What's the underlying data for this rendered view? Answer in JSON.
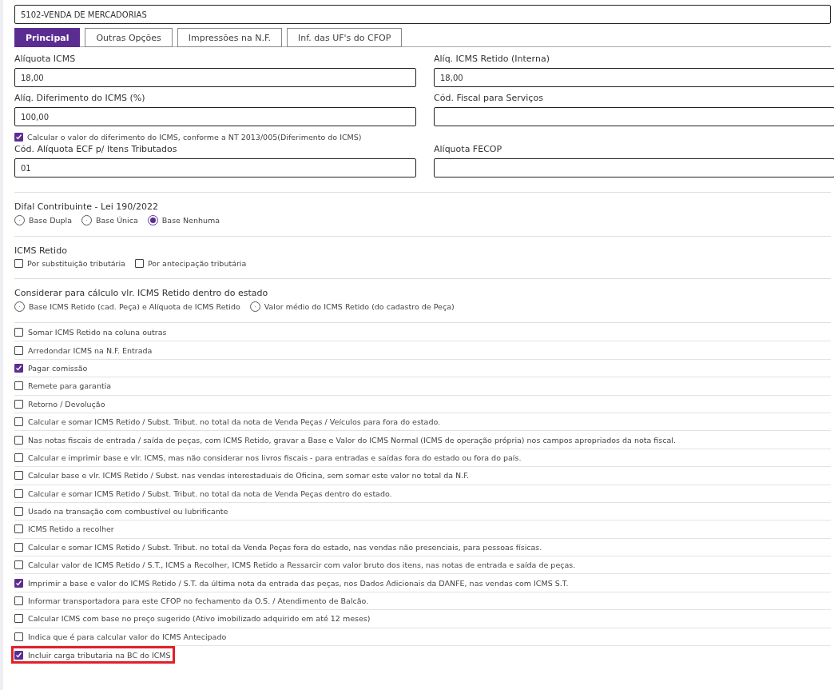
{
  "cfop_field": {
    "value": "5102-VENDA DE MERCADORIAS"
  },
  "tabs": [
    {
      "label": "Principal",
      "selected": true
    },
    {
      "label": "Outras Opções",
      "selected": false
    },
    {
      "label": "Impressões na N.F.",
      "selected": false
    },
    {
      "label": "Inf. das UF's do CFOP",
      "selected": false
    }
  ],
  "fields_row_1": [
    {
      "label": "Alíquota ICMS",
      "value": "18,00"
    },
    {
      "label": "Alíq. ICMS Retido (Interna)",
      "value": "18,00"
    }
  ],
  "fields_row_2": [
    {
      "label": "Alíq. Diferimento do ICMS (%)",
      "value": "100,00"
    },
    {
      "label": "Cód. Fiscal para Serviços"
    }
  ],
  "deferral_checkbox": {
    "label": "Calcular o valor do diferimento do ICMS, conforme a NT 2013/005(Diferimento do ICMS)",
    "checked": true
  },
  "fields_row_3": [
    {
      "label": "Cód. Alíquota ECF p/ Itens Tributados",
      "value": "01"
    },
    {
      "label": "Alíquota FECOP"
    }
  ],
  "difal": {
    "title": "Difal Contribuinte - Lei 190/2022",
    "options": [
      {
        "label": "Base Dupla",
        "selected": false
      },
      {
        "label": "Base Única",
        "selected": false
      },
      {
        "label": "Base Nenhuma",
        "selected": true
      }
    ]
  },
  "icms_retido": {
    "title": "ICMS Retido",
    "options": [
      {
        "label": "Por substituição tributária",
        "checked": false
      },
      {
        "label": "Por antecipação tributária",
        "checked": false
      }
    ]
  },
  "considerar": {
    "title": "Considerar para cálculo vlr. ICMS Retido dentro do estado",
    "options": [
      {
        "label": "Base ICMS Retido (cad. Peça) e Alíquota de ICMS Retido",
        "selected": false
      },
      {
        "label": "Valor médio do ICMS Retido (do cadastro de Peça)",
        "selected": false
      }
    ]
  },
  "options": [
    {
      "label": "Somar ICMS Retido na coluna outras",
      "checked": false
    },
    {
      "label": "Arredondar ICMS na N.F. Entrada",
      "checked": false
    },
    {
      "label": "Pagar comissão",
      "checked": true
    },
    {
      "label": "Remete para garantia",
      "checked": false
    },
    {
      "label": "Retorno / Devolução",
      "checked": false
    },
    {
      "label": "Calcular e somar ICMS Retido / Subst. Tribut. no total da nota de Venda Peças / Veículos para fora do estado.",
      "checked": false
    },
    {
      "label": "Nas notas fiscais de entrada / saída de peças, com ICMS Retido, gravar a Base e Valor do ICMS Normal (ICMS de operação própria) nos campos apropriados da nota fiscal.",
      "checked": false
    },
    {
      "label": "Calcular e imprimir base e vlr. ICMS, mas não considerar nos livros fiscais - para entradas e saídas fora do estado ou fora do país.",
      "checked": false
    },
    {
      "label": "Calcular base e vlr. ICMS Retido / Subst. nas vendas interestaduais de Oficina, sem somar este valor no total da N.F.",
      "checked": false
    },
    {
      "label": "Calcular e somar ICMS Retido / Subst. Tribut. no total da nota de Venda Peças dentro do estado.",
      "checked": false
    },
    {
      "label": "Usado na transação com combustível ou lubrificante",
      "checked": false
    },
    {
      "label": "ICMS Retido a recolher",
      "checked": false
    },
    {
      "label": "Calcular e somar ICMS Retido / Subst. Tribut. no total da Venda Peças fora do estado, nas vendas não presenciais, para pessoas físicas.",
      "checked": false
    },
    {
      "label": "Calcular valor de ICMS Retido / S.T., ICMS a Recolher, ICMS Retido a Ressarcir com valor bruto dos itens, nas notas de entrada e saída de peças.",
      "checked": false
    },
    {
      "label": "Imprimir a base e valor do ICMS Retido / S.T. da última nota da entrada das peças, nos Dados Adicionais da DANFE, nas vendas com ICMS S.T.",
      "checked": true
    },
    {
      "label": "Informar transportadora para este CFOP no fechamento da O.S. / Atendimento de Balcão.",
      "checked": false
    },
    {
      "label": "Calcular ICMS com base no preço sugerido (Ativo imobilizado adquirido em até 12 meses)",
      "checked": false
    },
    {
      "label": "Indica que é para calcular valor do ICMS Antecipado",
      "checked": false
    },
    {
      "label": "Incluir carga tributaria na BC do ICMS",
      "checked": true,
      "highlighted": true
    }
  ]
}
